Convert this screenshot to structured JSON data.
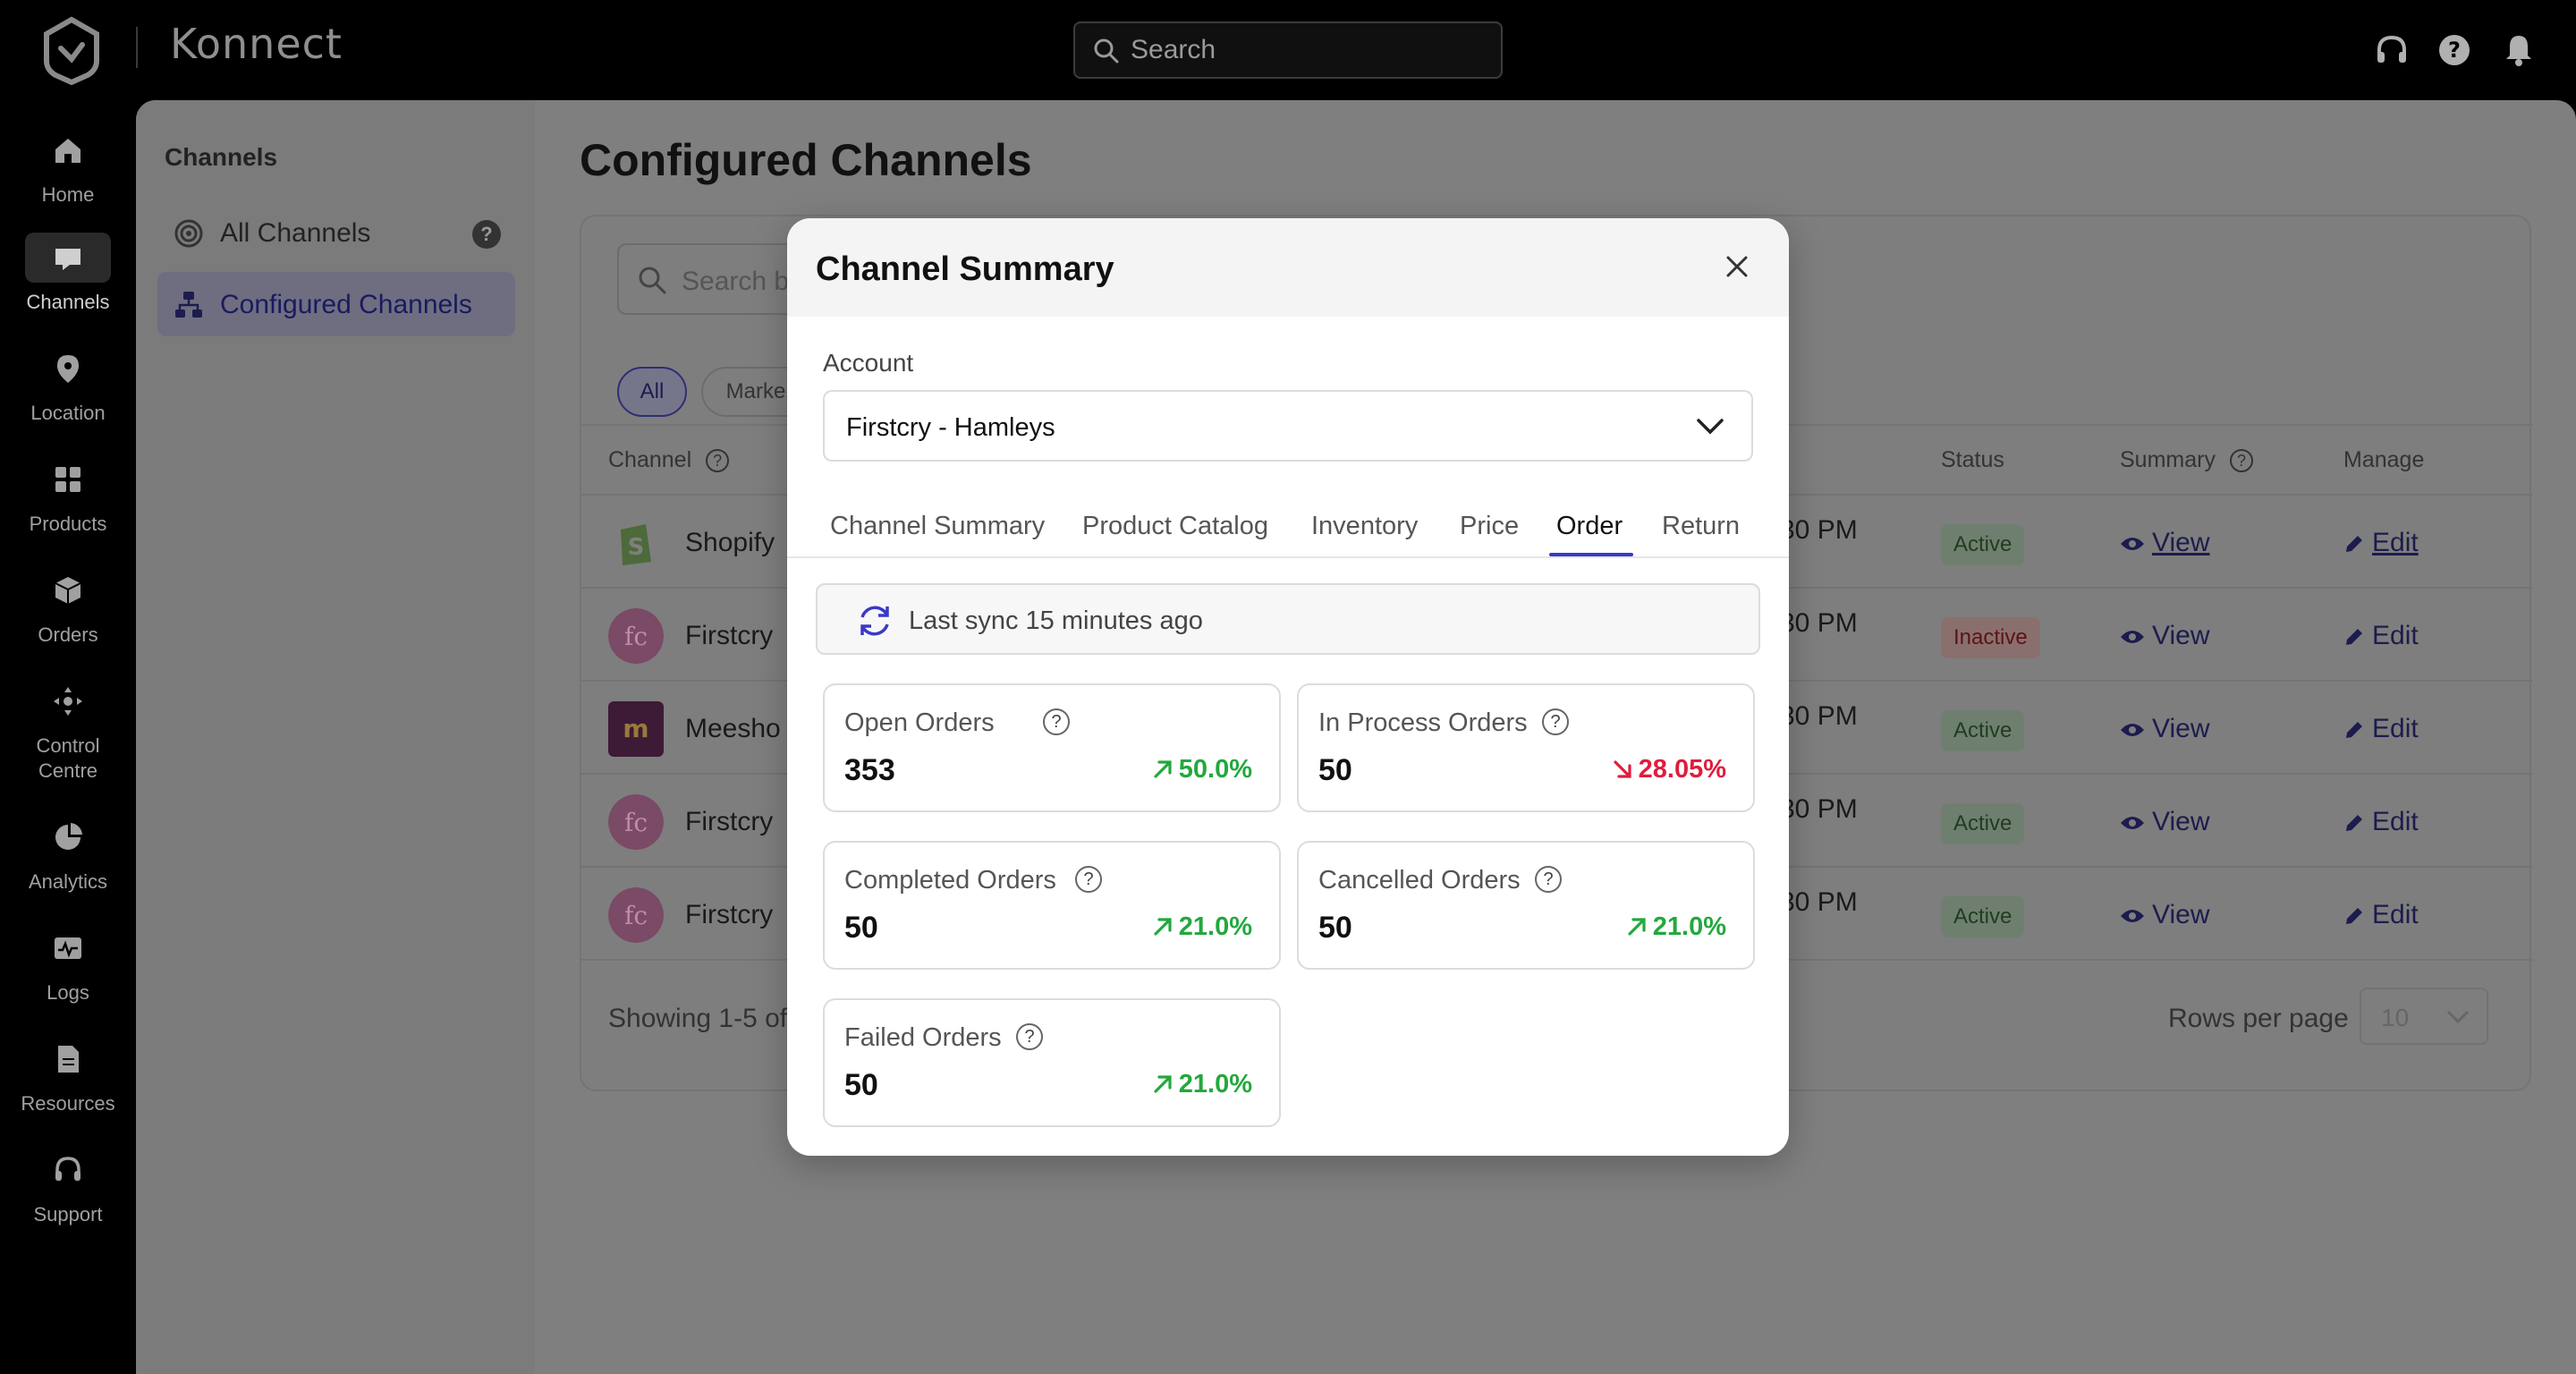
{
  "app": {
    "brand": "Konnect",
    "search_placeholder": "Search"
  },
  "rail": {
    "items": [
      {
        "label": "Home",
        "icon": "home-icon"
      },
      {
        "label": "Channels",
        "icon": "channels-icon",
        "active": true
      },
      {
        "label": "Location",
        "icon": "location-pin-icon"
      },
      {
        "label": "Products",
        "icon": "products-icon"
      },
      {
        "label": "Orders",
        "icon": "orders-box-icon"
      },
      {
        "label": "Control",
        "label2": "Centre",
        "icon": "control-centre-icon"
      },
      {
        "label": "Analytics",
        "icon": "pie-chart-icon"
      },
      {
        "label": "Logs",
        "icon": "logs-icon"
      },
      {
        "label": "Resources",
        "icon": "document-icon"
      },
      {
        "label": "Support",
        "icon": "headset-icon"
      }
    ]
  },
  "subnav": {
    "title": "Channels",
    "items": [
      {
        "label": "All Channels",
        "icon": "radar-icon",
        "help": "?"
      },
      {
        "label": "Configured Channels",
        "icon": "hierarchy-icon",
        "active": true
      }
    ]
  },
  "page": {
    "title": "Configured Channels",
    "search_placeholder": "Search b",
    "filters": [
      "All",
      "Marke"
    ],
    "columns": {
      "channel": "Channel",
      "status": "Status",
      "summary": "Summary",
      "manage": "Manage",
      "help": "?"
    },
    "rows": [
      {
        "name": "Shopify",
        "time": "30 PM",
        "status": "Active",
        "view": "View",
        "edit": "Edit"
      },
      {
        "name": "Firstcry",
        "time": "30 PM",
        "status": "Inactive",
        "view": "View",
        "edit": "Edit"
      },
      {
        "name": "Meesho",
        "time": "30 PM",
        "status": "Active",
        "view": "View",
        "edit": "Edit"
      },
      {
        "name": "Firstcry",
        "time": "30 PM",
        "status": "Active",
        "view": "View",
        "edit": "Edit"
      },
      {
        "name": "Firstcry",
        "time": "30 PM",
        "status": "Active",
        "view": "View",
        "edit": "Edit"
      }
    ],
    "footer": "Showing 1-5 of",
    "rows_per_page_label": "Rows per page",
    "rows_per_page_value": "10"
  },
  "modal": {
    "title": "Channel Summary",
    "account_label": "Account",
    "account_value": "Firstcry - Hamleys",
    "tabs": [
      "Channel Summary",
      "Product Catalog",
      "Inventory",
      "Price",
      "Order",
      "Return"
    ],
    "active_tab": "Order",
    "sync_text": "Last sync 15 minutes ago",
    "stats": [
      {
        "label": "Open Orders",
        "value": "353",
        "change": "50.0%",
        "trend": "up"
      },
      {
        "label": "In Process Orders",
        "value": "50",
        "change": "28.05%",
        "trend": "down"
      },
      {
        "label": "Completed Orders",
        "value": "50",
        "change": "21.0%",
        "trend": "up"
      },
      {
        "label": "Cancelled Orders",
        "value": "50",
        "change": "21.0%",
        "trend": "up"
      },
      {
        "label": "Failed Orders",
        "value": "50",
        "change": "21.0%",
        "trend": "up"
      }
    ],
    "help": "?"
  },
  "colors": {
    "accent": "#3b38c8",
    "up": "#23a83d",
    "down": "#e01c3d"
  }
}
